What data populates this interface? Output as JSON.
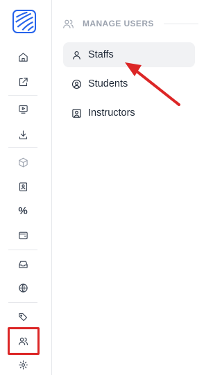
{
  "rail": {
    "icons": [
      "home-icon",
      "external-link-icon",
      "monitor-play-icon",
      "download-icon",
      "cube-icon",
      "contact-card-icon",
      "percent-icon",
      "wallet-icon",
      "inbox-icon",
      "globe-icon",
      "tags-icon",
      "users-icon",
      "gear-icon"
    ],
    "percent_glyph": "%"
  },
  "section": {
    "title": "MANAGE USERS"
  },
  "nav": {
    "items": [
      {
        "label": "Staffs",
        "icon": "user-icon",
        "active": true
      },
      {
        "label": "Students",
        "icon": "user-circle-icon",
        "active": false
      },
      {
        "label": "Instructors",
        "icon": "user-square-icon",
        "active": false
      }
    ]
  },
  "colors": {
    "accent": "#2563eb",
    "annotation": "#dc2626",
    "active_bg": "#f1f2f4"
  }
}
